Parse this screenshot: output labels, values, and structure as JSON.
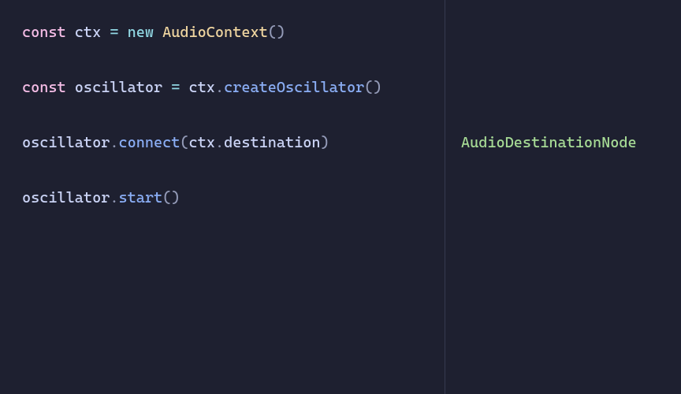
{
  "code": {
    "lines": [
      {
        "tokens": [
          {
            "t": "const ",
            "c": "kw"
          },
          {
            "t": "ctx ",
            "c": "var"
          },
          {
            "t": "= ",
            "c": "op"
          },
          {
            "t": "new ",
            "c": "op"
          },
          {
            "t": "AudioContext",
            "c": "cls"
          },
          {
            "t": "()",
            "c": "punct"
          }
        ]
      },
      {
        "tokens": []
      },
      {
        "tokens": [
          {
            "t": "const ",
            "c": "kw"
          },
          {
            "t": "oscillator ",
            "c": "var"
          },
          {
            "t": "= ",
            "c": "op"
          },
          {
            "t": "ctx",
            "c": "var"
          },
          {
            "t": ".",
            "c": "punct"
          },
          {
            "t": "createOscillator",
            "c": "method"
          },
          {
            "t": "()",
            "c": "punct"
          }
        ]
      },
      {
        "tokens": []
      },
      {
        "tokens": [
          {
            "t": "oscillator",
            "c": "var"
          },
          {
            "t": ".",
            "c": "punct"
          },
          {
            "t": "connect",
            "c": "method"
          },
          {
            "t": "(",
            "c": "punct"
          },
          {
            "t": "ctx",
            "c": "var"
          },
          {
            "t": ".",
            "c": "punct"
          },
          {
            "t": "destination",
            "c": "prop"
          },
          {
            "t": ")",
            "c": "punct"
          }
        ]
      },
      {
        "tokens": []
      },
      {
        "tokens": [
          {
            "t": "oscillator",
            "c": "var"
          },
          {
            "t": ".",
            "c": "punct"
          },
          {
            "t": "start",
            "c": "method"
          },
          {
            "t": "()",
            "c": "punct"
          }
        ]
      }
    ]
  },
  "output": {
    "lines": [
      "",
      "",
      "",
      "",
      "AudioDestinationNode",
      "",
      ""
    ]
  }
}
